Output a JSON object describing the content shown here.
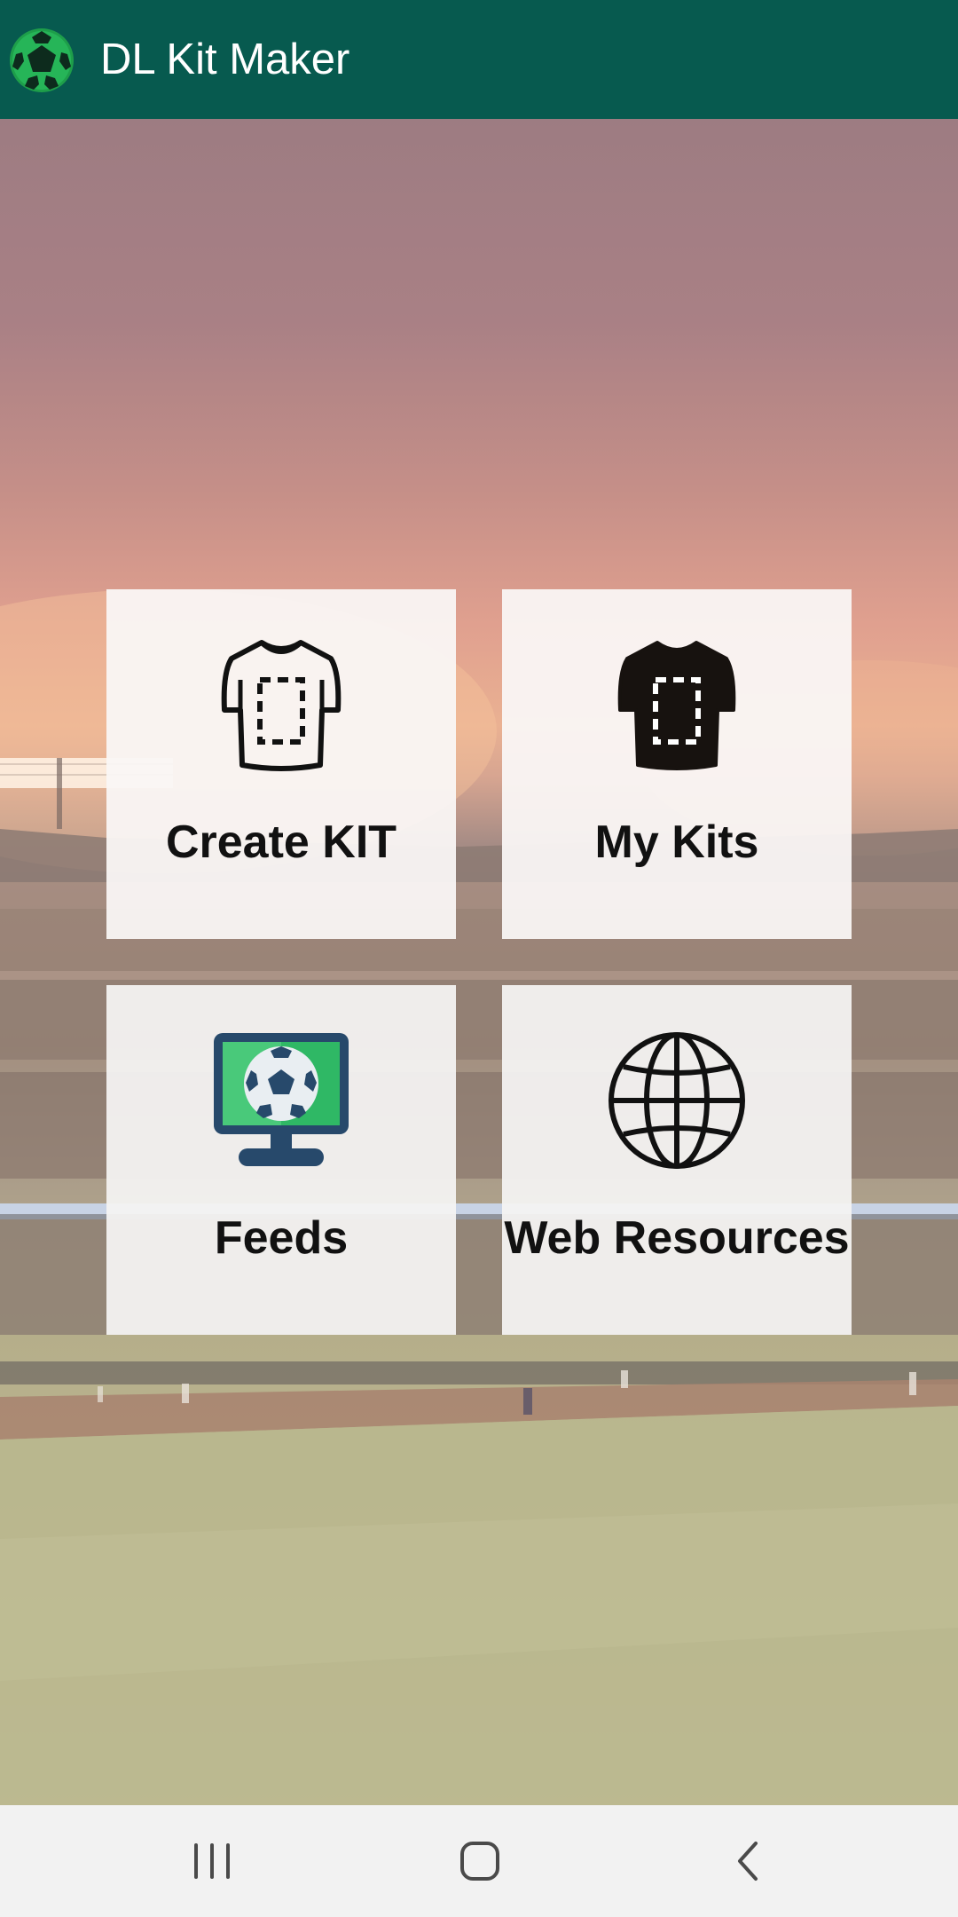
{
  "app_bar": {
    "title": "DL Kit Maker",
    "logo_icon": "soccer-ball-logo-icon",
    "background_color": "#075A4F"
  },
  "menu": {
    "tiles": [
      {
        "label": "Create KIT",
        "icon": "outline-shirt-icon"
      },
      {
        "label": "My Kits",
        "icon": "filled-shirt-icon"
      },
      {
        "label": "Feeds",
        "icon": "monitor-soccer-ball-icon"
      },
      {
        "label": "Web Resources",
        "icon": "globe-icon"
      }
    ]
  },
  "background": {
    "scene": "stadium-background"
  },
  "nav_bar": {
    "buttons": [
      "recent-apps-icon",
      "home-icon",
      "back-icon"
    ]
  }
}
